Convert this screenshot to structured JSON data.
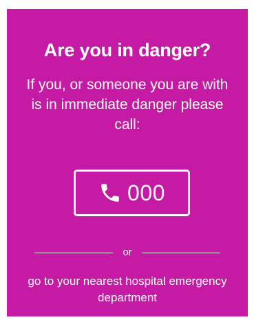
{
  "panel": {
    "background_color": "#c41aa4",
    "title": "Are you in danger?",
    "subtitle": "If you, or someone you are with is in immediate danger please call:",
    "call_button": {
      "icon": "phone-icon",
      "number": "000"
    },
    "divider_text": "or",
    "footer_text": "go to your nearest hospital emergency department"
  }
}
